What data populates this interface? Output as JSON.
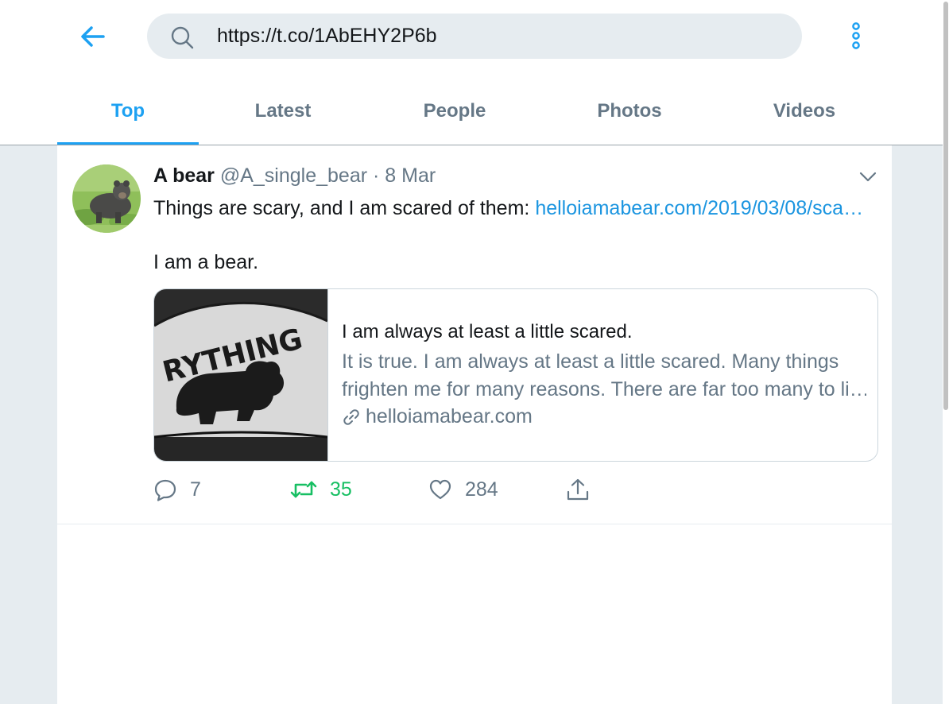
{
  "search": {
    "value": "https://t.co/1AbEHY2P6b"
  },
  "tabs": [
    {
      "label": "Top",
      "active": true
    },
    {
      "label": "Latest"
    },
    {
      "label": "People"
    },
    {
      "label": "Photos"
    },
    {
      "label": "Videos"
    }
  ],
  "tweet": {
    "name": "A bear",
    "handle": "@A_single_bear",
    "separator": "·",
    "date": "8 Mar",
    "text_line1": "Things are scary, and I am scared of them: ",
    "link": "helloiamabear.com/2019/03/08/sca…",
    "text_line2": "I am a bear.",
    "card": {
      "title": "I am always at least a little scared.",
      "desc_line1": "It is true. I am always at least a little scared. Many things",
      "desc_line2": "frighten me for many reasons. There are far too many to li…",
      "domain": "helloiamabear.com",
      "image_text": "RYTHING"
    },
    "actions": {
      "replies": "7",
      "retweets": "35",
      "likes": "284"
    }
  },
  "colors": {
    "accent": "#1da1f2",
    "link": "#1b95e0",
    "retweet": "#17bf63",
    "secondary": "#657786",
    "background": "#e6ecf0"
  },
  "icons": [
    "back-arrow-icon",
    "search-icon",
    "more-vertical-icon",
    "chevron-down-icon",
    "link-icon",
    "reply-icon",
    "retweet-icon",
    "like-icon",
    "share-icon"
  ]
}
